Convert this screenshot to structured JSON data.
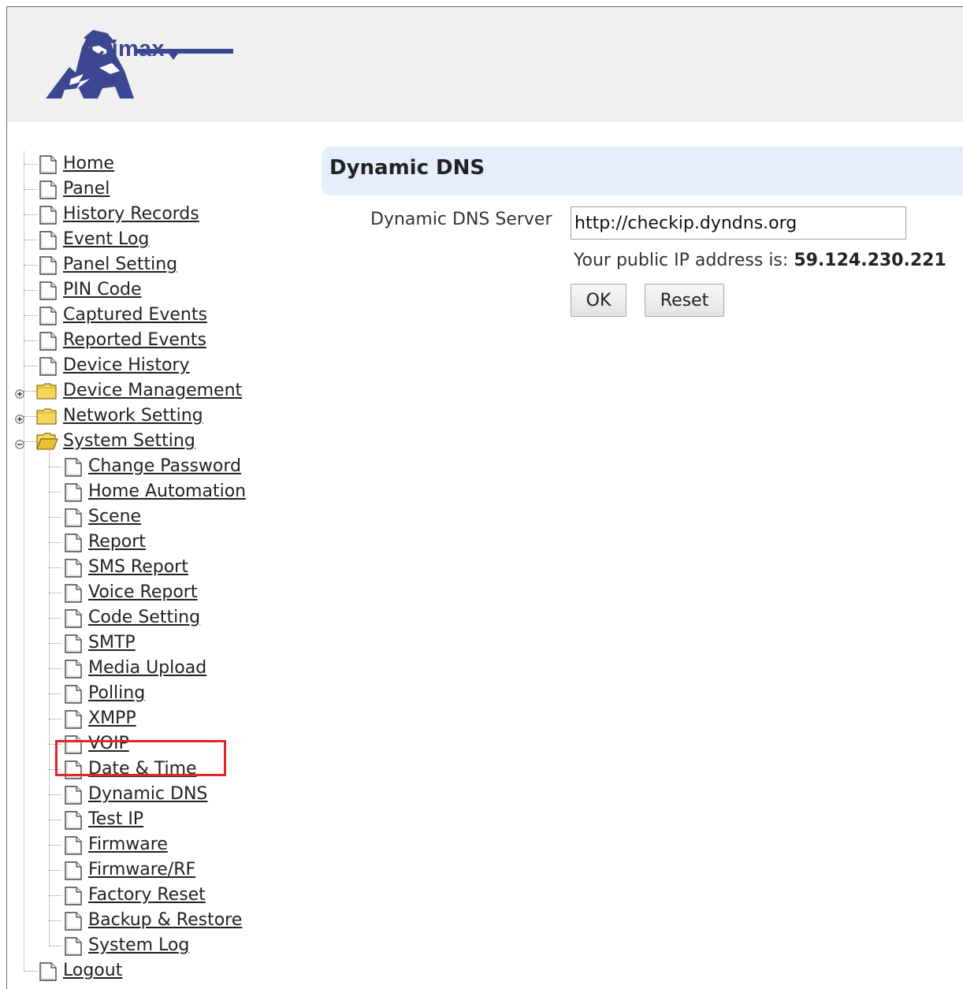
{
  "brand": {
    "name": "Climax",
    "colors": {
      "logo": "#3d4691",
      "header_bg": "#f0f0f0",
      "title_bar_bg": "#e5eefb",
      "highlight": "#e3242b"
    }
  },
  "nav": {
    "top": [
      {
        "label": "Home",
        "icon": "doc-icon"
      },
      {
        "label": "Panel",
        "icon": "doc-icon"
      },
      {
        "label": "History Records",
        "icon": "doc-icon"
      },
      {
        "label": "Event Log",
        "icon": "doc-icon"
      },
      {
        "label": "Panel Setting",
        "icon": "doc-icon"
      },
      {
        "label": "PIN Code",
        "icon": "doc-icon"
      },
      {
        "label": "Captured Events",
        "icon": "doc-icon"
      },
      {
        "label": "Reported Events",
        "icon": "doc-icon"
      },
      {
        "label": "Device History",
        "icon": "doc-icon"
      },
      {
        "label": "Device Management",
        "icon": "folder-icon",
        "expander": "plus"
      },
      {
        "label": "Network Setting",
        "icon": "folder-icon",
        "expander": "plus"
      },
      {
        "label": "System Setting",
        "icon": "folder-open-icon",
        "expander": "minus"
      }
    ],
    "system_setting_children": [
      "Change Password",
      "Home Automation",
      "Scene",
      "Report",
      "SMS Report",
      "Voice Report",
      "Code Setting",
      "SMTP",
      "Media Upload",
      "Polling",
      "XMPP",
      "VOIP",
      "Date & Time",
      "Dynamic DNS",
      "Test IP",
      "Firmware",
      "Firmware/RF",
      "Factory Reset",
      "Backup & Restore",
      "System Log"
    ],
    "bottom": [
      {
        "label": "Logout",
        "icon": "doc-icon"
      }
    ],
    "highlighted_item": "Date & Time"
  },
  "content": {
    "title": "Dynamic DNS",
    "server_label": "Dynamic DNS Server",
    "server_value": "http://checkip.dyndns.org",
    "ip_prefix": "Your public IP address is:",
    "ip_value": "59.124.230.221",
    "ok_label": "OK",
    "reset_label": "Reset"
  }
}
